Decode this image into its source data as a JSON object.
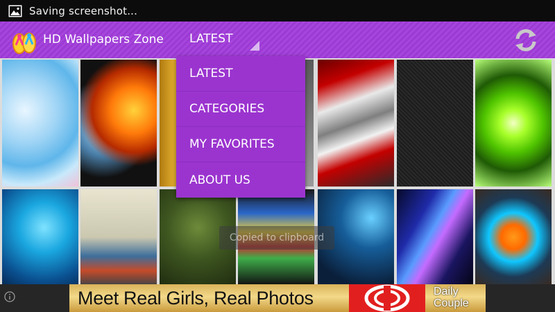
{
  "statusbar": {
    "notification_text": "Saving screenshot..."
  },
  "appbar": {
    "title": "HD Wallpapers Zone",
    "spinner_selected": "LATEST",
    "refresh_icon": "refresh-icon",
    "logo_icon": "flip-flops-logo"
  },
  "dropdown": {
    "items": [
      {
        "label": "LATEST"
      },
      {
        "label": "CATEGORIES"
      },
      {
        "label": "MY FAVORITES"
      },
      {
        "label": "ABOUT US"
      }
    ]
  },
  "toast": {
    "text": "Copied to clipboard"
  },
  "ad": {
    "headline": "Meet Real Girls, Real Photos",
    "brand_line1": "Daily",
    "brand_line2": "Couple"
  },
  "colors": {
    "accent": "#9c3ad4",
    "dropdown_bg": "#9b34cf",
    "statusbar_bg": "#0c0c0c"
  }
}
